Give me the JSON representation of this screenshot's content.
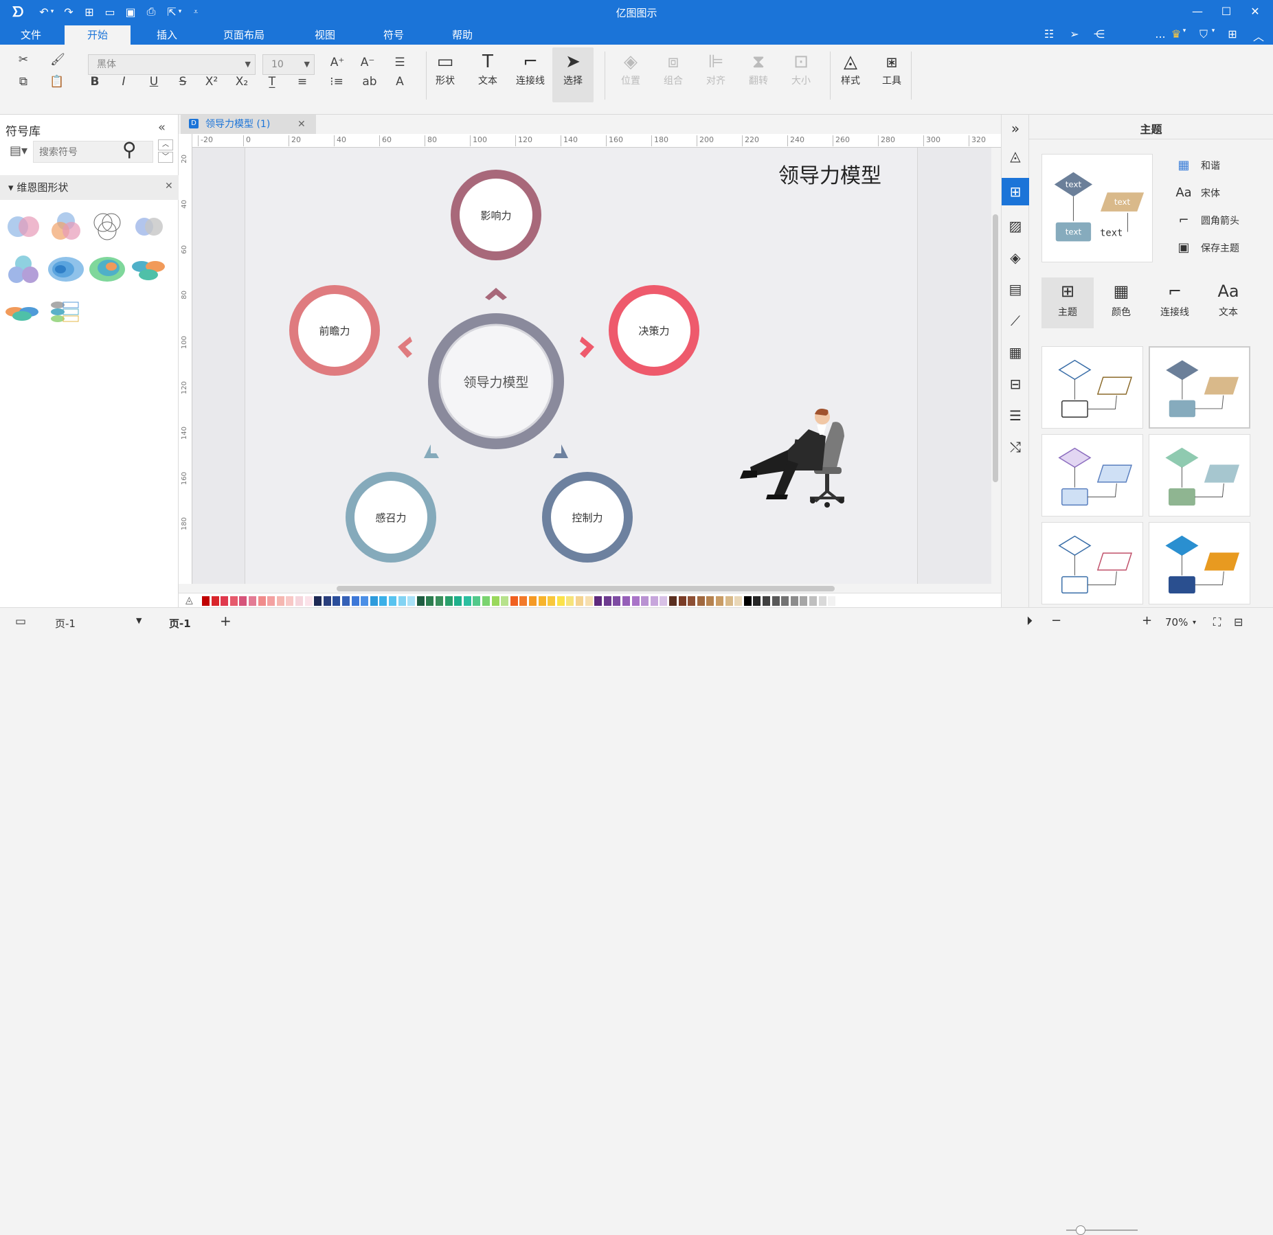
{
  "app": {
    "title": "亿图图示"
  },
  "menu": {
    "tabs": [
      "文件",
      "开始",
      "插入",
      "页面布局",
      "视图",
      "符号",
      "帮助"
    ],
    "active": "开始",
    "more": "..."
  },
  "ribbon": {
    "font_name": "黑体",
    "font_size": "10",
    "shape": "形状",
    "text": "文本",
    "connector": "连接线",
    "select": "选择",
    "position": "位置",
    "group": "组合",
    "align": "对齐",
    "flip": "翻转",
    "size": "大小",
    "style": "样式",
    "tools": "工具"
  },
  "leftpanel": {
    "title": "符号库",
    "search_placeholder": "搜索符号",
    "category": "维恩图形状"
  },
  "doc": {
    "tab_title": "领导力模型 (1)"
  },
  "hruler": [
    "-20",
    "0",
    "20",
    "40",
    "60",
    "80",
    "100",
    "120",
    "140",
    "160",
    "180",
    "200",
    "220",
    "240",
    "260",
    "280",
    "300",
    "320"
  ],
  "vruler": [
    "20",
    "40",
    "60",
    "80",
    "100",
    "120",
    "140",
    "160",
    "180"
  ],
  "diagram": {
    "title": "领导力模型",
    "center": "领导力模型",
    "nodes": [
      {
        "id": "top",
        "label": "影响力",
        "color": "#a8687a"
      },
      {
        "id": "left",
        "label": "前瞻力",
        "color": "#df7b7f"
      },
      {
        "id": "right",
        "label": "决策力",
        "color": "#ee5a6c"
      },
      {
        "id": "bl",
        "label": "感召力",
        "color": "#85aabb"
      },
      {
        "id": "br",
        "label": "控制力",
        "color": "#6d819f"
      }
    ],
    "center_color": "#8a8a9c"
  },
  "rightpanel": {
    "title": "主题",
    "preview_text": "text",
    "options": [
      "和谐",
      "宋体",
      "圆角箭头",
      "保存主题"
    ],
    "buttons": [
      "主题",
      "颜色",
      "连接线",
      "文本"
    ]
  },
  "status": {
    "page_select": "页-1",
    "page_tab": "页-1",
    "add": "+",
    "zoom": "70%"
  }
}
